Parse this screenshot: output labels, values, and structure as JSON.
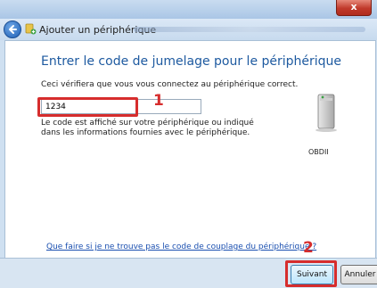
{
  "window": {
    "title": "Ajouter un périphérique",
    "close_label": "x"
  },
  "wizard": {
    "heading": "Entrer le code de jumelage pour le périphérique",
    "subtext": "Ceci vérifiera que vous vous connectez au périphérique correct.",
    "code_value": "1234",
    "help_text": "Le code est affiché sur votre périphérique ou indiqué dans les informations fournies avec le périphérique.",
    "device_name": "OBDII",
    "help_link": "Que faire si je ne trouve pas le code de couplage du périphérique ?"
  },
  "annotations": {
    "step1": "1",
    "step2": "2",
    "highlight_color": "#d62d2d"
  },
  "footer": {
    "next_label": "Suivant",
    "cancel_label": "Annuler"
  },
  "icons": {
    "back": "back-arrow-icon",
    "wizard": "add-device-icon",
    "device": "computer-tower-icon"
  }
}
